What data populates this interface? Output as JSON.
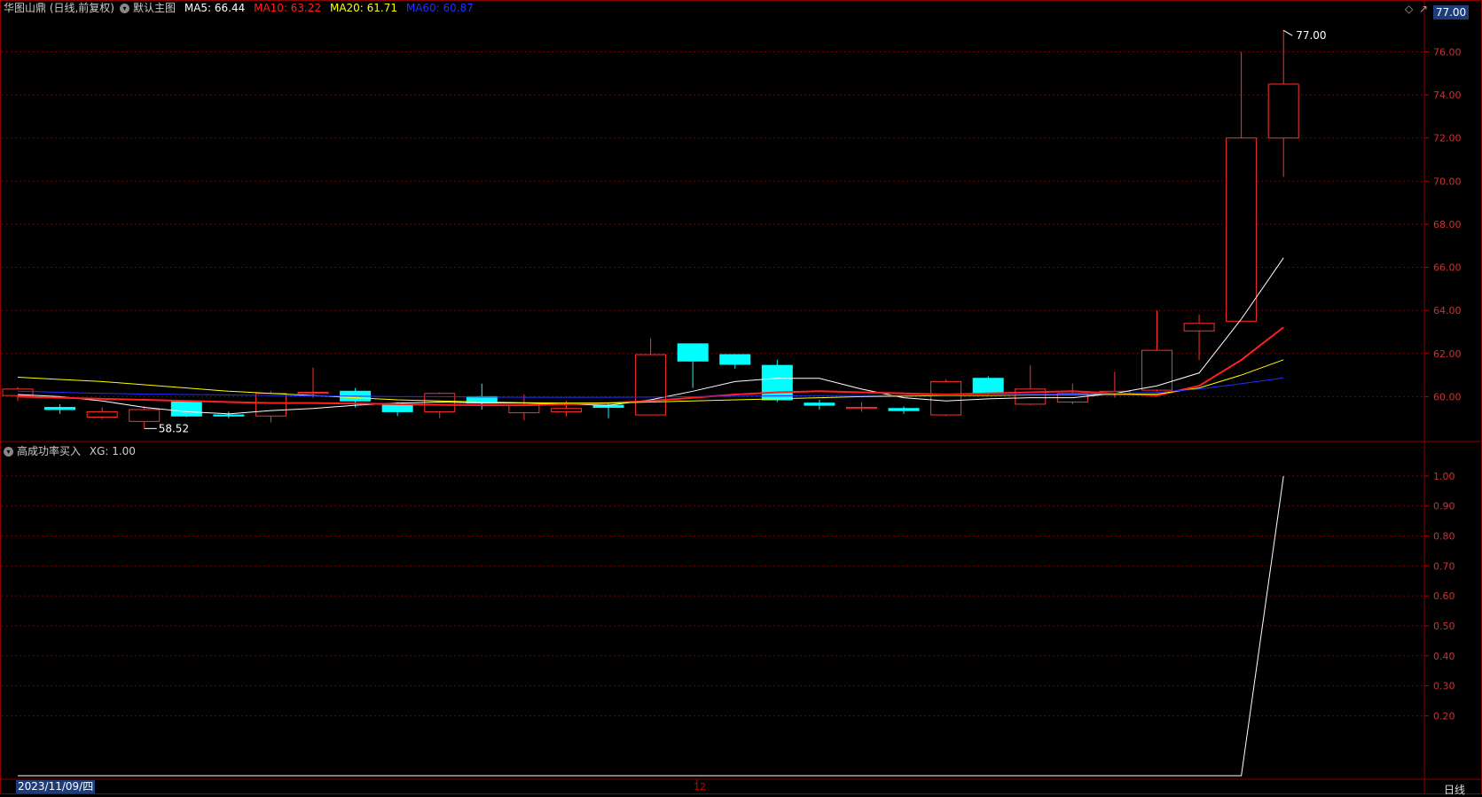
{
  "header": {
    "stock_title": "华图山鼎 (日线,前复权)",
    "template_label": "默认主图",
    "ma5": {
      "label": "MA5: 66.44",
      "color": "#ffffff"
    },
    "ma10": {
      "label": "MA10: 63.22",
      "color": "#ff2020"
    },
    "ma20": {
      "label": "MA20: 61.71",
      "color": "#ffff00"
    },
    "ma60": {
      "label": "MA60: 60.87",
      "color": "#2030ff"
    }
  },
  "indicator_header": {
    "name": "高成功率买入",
    "value_label": "XG: 1.00"
  },
  "current_price_tag": "77.00",
  "date_label": "2023/11/09/四",
  "x_tick_label": "12",
  "period_label": "日线",
  "chart_data": [
    {
      "type": "candlestick",
      "title": "华图山鼎 (日线,前复权)",
      "ylim": [
        58.0,
        77.5
      ],
      "y_ticks": [
        "76.00",
        "74.00",
        "72.00",
        "70.00",
        "68.00",
        "66.00",
        "64.00",
        "62.00",
        "60.00"
      ],
      "y_tick_values": [
        76,
        74,
        72,
        70,
        68,
        66,
        64,
        62,
        60
      ],
      "annotations": [
        {
          "label": "77.00",
          "value": 77.0,
          "index": 30
        },
        {
          "label": "58.52",
          "value": 58.52,
          "index": 3
        }
      ],
      "candles": [
        {
          "o": 60.05,
          "h": 60.45,
          "l": 59.8,
          "c": 60.35
        },
        {
          "o": 59.5,
          "h": 59.65,
          "l": 59.2,
          "c": 59.4
        },
        {
          "o": 59.05,
          "h": 59.5,
          "l": 58.95,
          "c": 59.3
        },
        {
          "o": 58.85,
          "h": 59.55,
          "l": 58.52,
          "c": 59.4
        },
        {
          "o": 59.75,
          "h": 59.8,
          "l": 59.05,
          "c": 59.1
        },
        {
          "o": 59.15,
          "h": 59.3,
          "l": 59.0,
          "c": 59.1
        },
        {
          "o": 59.1,
          "h": 60.25,
          "l": 58.8,
          "c": 60.15
        },
        {
          "o": 60.15,
          "h": 61.35,
          "l": 59.95,
          "c": 60.2
        },
        {
          "o": 60.25,
          "h": 60.4,
          "l": 59.5,
          "c": 59.8
        },
        {
          "o": 59.6,
          "h": 59.75,
          "l": 59.1,
          "c": 59.3
        },
        {
          "o": 59.3,
          "h": 60.2,
          "l": 59.0,
          "c": 60.15
        },
        {
          "o": 60.0,
          "h": 60.6,
          "l": 59.4,
          "c": 59.7
        },
        {
          "o": 59.25,
          "h": 60.1,
          "l": 58.9,
          "c": 59.6
        },
        {
          "o": 59.3,
          "h": 59.8,
          "l": 59.1,
          "c": 59.45
        },
        {
          "o": 59.6,
          "h": 59.7,
          "l": 59.0,
          "c": 59.5
        },
        {
          "o": 59.15,
          "h": 62.7,
          "l": 59.15,
          "c": 61.95
        },
        {
          "o": 62.45,
          "h": 62.45,
          "l": 60.4,
          "c": 61.65
        },
        {
          "o": 61.95,
          "h": 61.95,
          "l": 61.3,
          "c": 61.5
        },
        {
          "o": 61.45,
          "h": 61.7,
          "l": 59.75,
          "c": 59.85
        },
        {
          "o": 59.7,
          "h": 59.85,
          "l": 59.4,
          "c": 59.6
        },
        {
          "o": 59.45,
          "h": 59.75,
          "l": 59.3,
          "c": 59.5
        },
        {
          "o": 59.45,
          "h": 59.55,
          "l": 59.2,
          "c": 59.35
        },
        {
          "o": 59.15,
          "h": 60.8,
          "l": 59.1,
          "c": 60.7
        },
        {
          "o": 60.85,
          "h": 60.95,
          "l": 60.05,
          "c": 60.15
        },
        {
          "o": 59.65,
          "h": 61.45,
          "l": 59.6,
          "c": 60.35
        },
        {
          "o": 59.75,
          "h": 60.6,
          "l": 59.65,
          "c": 60.15
        },
        {
          "o": 60.15,
          "h": 61.15,
          "l": 59.95,
          "c": 60.25
        },
        {
          "o": 60.3,
          "h": 64.0,
          "l": 60.25,
          "c": 62.15
        },
        {
          "o": 63.05,
          "h": 63.8,
          "l": 61.7,
          "c": 63.4
        },
        {
          "o": 63.5,
          "h": 76.0,
          "l": 63.5,
          "c": 72.0
        },
        {
          "o": 72.0,
          "h": 77.0,
          "l": 70.2,
          "c": 74.5
        }
      ],
      "series": [
        {
          "name": "MA5",
          "values": [
            60.1,
            60.0,
            59.8,
            59.5,
            59.3,
            59.2,
            59.35,
            59.45,
            59.6,
            59.7,
            59.75,
            59.7,
            59.7,
            59.65,
            59.6,
            59.85,
            60.25,
            60.7,
            60.85,
            60.85,
            60.35,
            59.95,
            59.8,
            59.9,
            59.95,
            59.95,
            60.15,
            60.5,
            61.1,
            63.6,
            66.44
          ]
        },
        {
          "name": "MA10",
          "values": [
            60.0,
            59.95,
            59.9,
            59.85,
            59.8,
            59.75,
            59.7,
            59.7,
            59.68,
            59.65,
            59.62,
            59.6,
            59.6,
            59.65,
            59.7,
            59.8,
            59.95,
            60.1,
            60.2,
            60.25,
            60.2,
            60.15,
            60.1,
            60.15,
            60.2,
            60.25,
            60.15,
            60.05,
            60.5,
            61.7,
            63.22
          ]
        },
        {
          "name": "MA20",
          "values": [
            60.9,
            60.8,
            60.7,
            60.55,
            60.4,
            60.25,
            60.15,
            60.05,
            59.95,
            59.85,
            59.8,
            59.75,
            59.72,
            59.7,
            59.7,
            59.75,
            59.8,
            59.85,
            59.9,
            59.95,
            60.0,
            60.02,
            60.05,
            60.05,
            60.08,
            60.1,
            60.1,
            60.12,
            60.4,
            61.0,
            61.71
          ]
        },
        {
          "name": "MA60",
          "values": [
            60.25,
            60.2,
            60.15,
            60.12,
            60.1,
            60.08,
            60.05,
            60.03,
            60.02,
            60.0,
            60.0,
            59.98,
            59.97,
            59.97,
            59.97,
            59.98,
            60.0,
            60.02,
            60.03,
            60.05,
            60.05,
            60.06,
            60.07,
            60.08,
            60.1,
            60.12,
            60.15,
            60.2,
            60.35,
            60.6,
            60.87
          ]
        }
      ]
    },
    {
      "type": "line",
      "title": "高成功率买入",
      "ylim": [
        0,
        1.05
      ],
      "y_ticks": [
        "1.00",
        "0.90",
        "0.80",
        "0.70",
        "0.60",
        "0.50",
        "0.40",
        "0.30",
        "0.20"
      ],
      "y_tick_values": [
        1.0,
        0.9,
        0.8,
        0.7,
        0.6,
        0.5,
        0.4,
        0.3,
        0.2
      ],
      "series": [
        {
          "name": "XG",
          "values": [
            0,
            0,
            0,
            0,
            0,
            0,
            0,
            0,
            0,
            0,
            0,
            0,
            0,
            0,
            0,
            0,
            0,
            0,
            0,
            0,
            0,
            0,
            0,
            0,
            0,
            0,
            0,
            0,
            0,
            0,
            1
          ]
        }
      ]
    }
  ]
}
